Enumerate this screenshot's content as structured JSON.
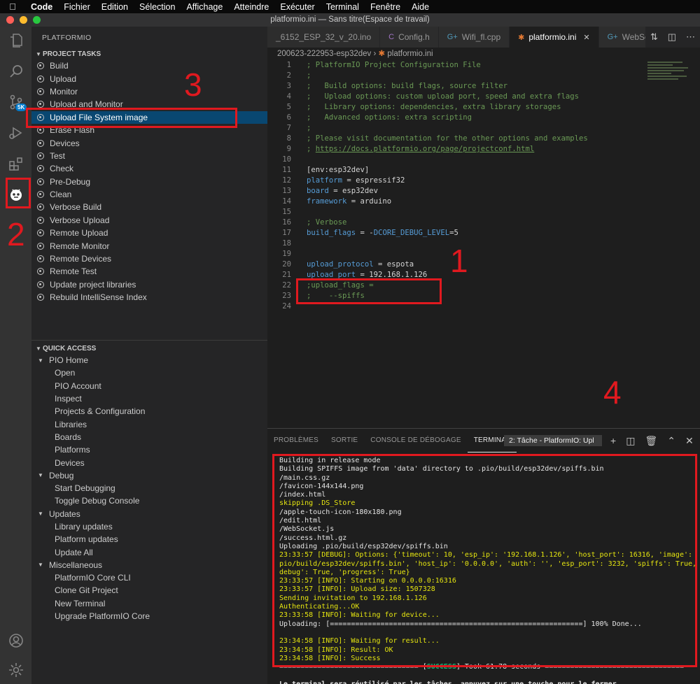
{
  "menubar": {
    "app": "Code",
    "items": [
      "Fichier",
      "Edition",
      "Sélection",
      "Affichage",
      "Atteindre",
      "Exécuter",
      "Terminal",
      "Fenêtre",
      "Aide"
    ]
  },
  "window_title": "platformio.ini — Sans titre(Espace de travail)",
  "activity": {
    "badge": "5K"
  },
  "sidebar": {
    "title": "PLATFORMIO",
    "project_tasks_header": "PROJECT TASKS",
    "tasks": [
      "Build",
      "Upload",
      "Monitor",
      "Upload and Monitor",
      "Upload File System image",
      "Erase Flash",
      "Devices",
      "Test",
      "Check",
      "Pre-Debug",
      "Clean",
      "Verbose Build",
      "Verbose Upload",
      "Remote Upload",
      "Remote Monitor",
      "Remote Devices",
      "Remote Test",
      "Update project libraries",
      "Rebuild IntelliSense Index"
    ],
    "selected_task": "Upload File System image",
    "quick_access_header": "QUICK ACCESS",
    "quick_access": [
      {
        "label": "PIO Home",
        "children": [
          "Open",
          "PIO Account",
          "Inspect",
          "Projects & Configuration",
          "Libraries",
          "Boards",
          "Platforms",
          "Devices"
        ]
      },
      {
        "label": "Debug",
        "children": [
          "Start Debugging",
          "Toggle Debug Console"
        ]
      },
      {
        "label": "Updates",
        "children": [
          "Library updates",
          "Platform updates",
          "Update All"
        ]
      },
      {
        "label": "Miscellaneous",
        "children": [
          "PlatformIO Core CLI",
          "Clone Git Project",
          "New Terminal",
          "Upgrade PlatformIO Core"
        ]
      }
    ]
  },
  "editor": {
    "tabs": [
      {
        "label": "_6152_ESP_32_v_20.ino",
        "icon": "",
        "active": false
      },
      {
        "label": "Config.h",
        "icon": "C",
        "active": false
      },
      {
        "label": "Wifi_fl.cpp",
        "icon": "G+",
        "active": false
      },
      {
        "label": "platformio.ini",
        "icon": "ant",
        "active": true
      },
      {
        "label": "WebSocke",
        "icon": "G+",
        "active": false
      }
    ],
    "breadcrumb": [
      "200623-222953-esp32dev",
      "platformio.ini"
    ],
    "lines": [
      {
        "n": "1",
        "parts": [
          {
            "c": "cm",
            "t": "; PlatformIO Project Configuration File"
          }
        ]
      },
      {
        "n": "2",
        "parts": [
          {
            "c": "cm",
            "t": ";"
          }
        ]
      },
      {
        "n": "3",
        "parts": [
          {
            "c": "cm",
            "t": ";   Build options: build flags, source filter"
          }
        ]
      },
      {
        "n": "4",
        "parts": [
          {
            "c": "cm",
            "t": ";   Upload options: custom upload port, speed and extra flags"
          }
        ]
      },
      {
        "n": "5",
        "parts": [
          {
            "c": "cm",
            "t": ";   Library options: dependencies, extra library storages"
          }
        ]
      },
      {
        "n": "6",
        "parts": [
          {
            "c": "cm",
            "t": ";   Advanced options: extra scripting"
          }
        ]
      },
      {
        "n": "7",
        "parts": [
          {
            "c": "cm",
            "t": ";"
          }
        ]
      },
      {
        "n": "8",
        "parts": [
          {
            "c": "cm",
            "t": "; Please visit documentation for the other options and examples"
          }
        ]
      },
      {
        "n": "9",
        "parts": [
          {
            "c": "cm",
            "t": "; "
          },
          {
            "c": "link",
            "t": "https://docs.platformio.org/page/projectconf.html"
          }
        ]
      },
      {
        "n": "10",
        "parts": []
      },
      {
        "n": "11",
        "parts": [
          {
            "c": "txt",
            "t": "[env:esp32dev]"
          }
        ]
      },
      {
        "n": "12",
        "parts": [
          {
            "c": "key",
            "t": "platform"
          },
          {
            "c": "txt",
            "t": " = espressif32"
          }
        ]
      },
      {
        "n": "13",
        "parts": [
          {
            "c": "key",
            "t": "board"
          },
          {
            "c": "txt",
            "t": " = esp32dev"
          }
        ]
      },
      {
        "n": "14",
        "parts": [
          {
            "c": "key",
            "t": "framework"
          },
          {
            "c": "txt",
            "t": " = arduino"
          }
        ]
      },
      {
        "n": "15",
        "parts": []
      },
      {
        "n": "16",
        "parts": [
          {
            "c": "cm",
            "t": "; Verbose"
          }
        ]
      },
      {
        "n": "17",
        "parts": [
          {
            "c": "key",
            "t": "build_flags"
          },
          {
            "c": "txt",
            "t": " = -"
          },
          {
            "c": "key",
            "t": "DCORE_DEBUG_LEVEL"
          },
          {
            "c": "txt",
            "t": "=5"
          }
        ]
      },
      {
        "n": "18",
        "parts": []
      },
      {
        "n": "19",
        "parts": []
      },
      {
        "n": "20",
        "parts": [
          {
            "c": "key",
            "t": "upload_protocol"
          },
          {
            "c": "txt",
            "t": " = espota"
          }
        ]
      },
      {
        "n": "21",
        "parts": [
          {
            "c": "key",
            "t": "upload_port"
          },
          {
            "c": "txt",
            "t": " = 192.168.1.126"
          }
        ]
      },
      {
        "n": "22",
        "parts": [
          {
            "c": "cm",
            "t": ";upload_flags ="
          }
        ]
      },
      {
        "n": "23",
        "parts": [
          {
            "c": "cm",
            "t": ";    --spiffs"
          }
        ]
      },
      {
        "n": "24",
        "parts": []
      }
    ]
  },
  "panel": {
    "tabs": [
      "PROBLÈMES",
      "SORTIE",
      "CONSOLE DE DÉBOGAGE",
      "TERMINAL"
    ],
    "active_tab": "TERMINAL",
    "terminal_select": "2: Tâche - PlatformIO: Upl",
    "terminal_lines": [
      {
        "c": "normal",
        "t": "Building in release mode"
      },
      {
        "c": "normal",
        "t": "Building SPIFFS image from 'data' directory to .pio/build/esp32dev/spiffs.bin"
      },
      {
        "c": "normal",
        "t": "/main.css.gz"
      },
      {
        "c": "normal",
        "t": "/favicon-144x144.png"
      },
      {
        "c": "normal",
        "t": "/index.html"
      },
      {
        "c": "yellow",
        "t": "skipping .DS_Store"
      },
      {
        "c": "normal",
        "t": "/apple-touch-icon-180x180.png"
      },
      {
        "c": "normal",
        "t": "/edit.html"
      },
      {
        "c": "normal",
        "t": "/WebSocket.js"
      },
      {
        "c": "normal",
        "t": "/success.html.gz"
      },
      {
        "c": "normal",
        "t": "Uploading .pio/build/esp32dev/spiffs.bin"
      },
      {
        "c": "yellow",
        "t": "23:33:57 [DEBUG]: Options: {'timeout': 10, 'esp_ip': '192.168.1.126', 'host_port': 16316, 'image': '."
      },
      {
        "c": "yellow",
        "t": "pio/build/esp32dev/spiffs.bin', 'host_ip': '0.0.0.0', 'auth': '', 'esp_port': 3232, 'spiffs': True, '"
      },
      {
        "c": "yellow",
        "t": "debug': True, 'progress': True}"
      },
      {
        "c": "yellow",
        "t": "23:33:57 [INFO]: Starting on 0.0.0.0:16316"
      },
      {
        "c": "yellow",
        "t": "23:33:57 [INFO]: Upload size: 1507328"
      },
      {
        "c": "yellow",
        "t": "Sending invitation to 192.168.1.126"
      },
      {
        "c": "yellow",
        "t": "Authenticating...OK"
      },
      {
        "c": "yellow",
        "t": "23:33:58 [INFO]: Waiting for device..."
      },
      {
        "c": "normal",
        "t": "Uploading: [============================================================] 100% Done..."
      },
      {
        "c": "normal",
        "t": ""
      },
      {
        "c": "yellow",
        "t": "23:34:58 [INFO]: Waiting for result..."
      },
      {
        "c": "yellow",
        "t": "23:34:58 [INFO]: Result: OK"
      },
      {
        "c": "yellow",
        "t": "23:34:58 [INFO]: Success"
      }
    ],
    "success_prefix": "================================= [",
    "success_word": "SUCCESS",
    "success_suffix": "] Took 61.78 seconds =================================",
    "footer": "Le terminal sera réutilisé par les tâches, appuyez sur une touche pour le fermer."
  },
  "annotations": [
    "1",
    "2",
    "3",
    "4"
  ],
  "colors": {
    "accent": "#007acc",
    "annotation": "#e0191f",
    "selection": "#094771"
  }
}
